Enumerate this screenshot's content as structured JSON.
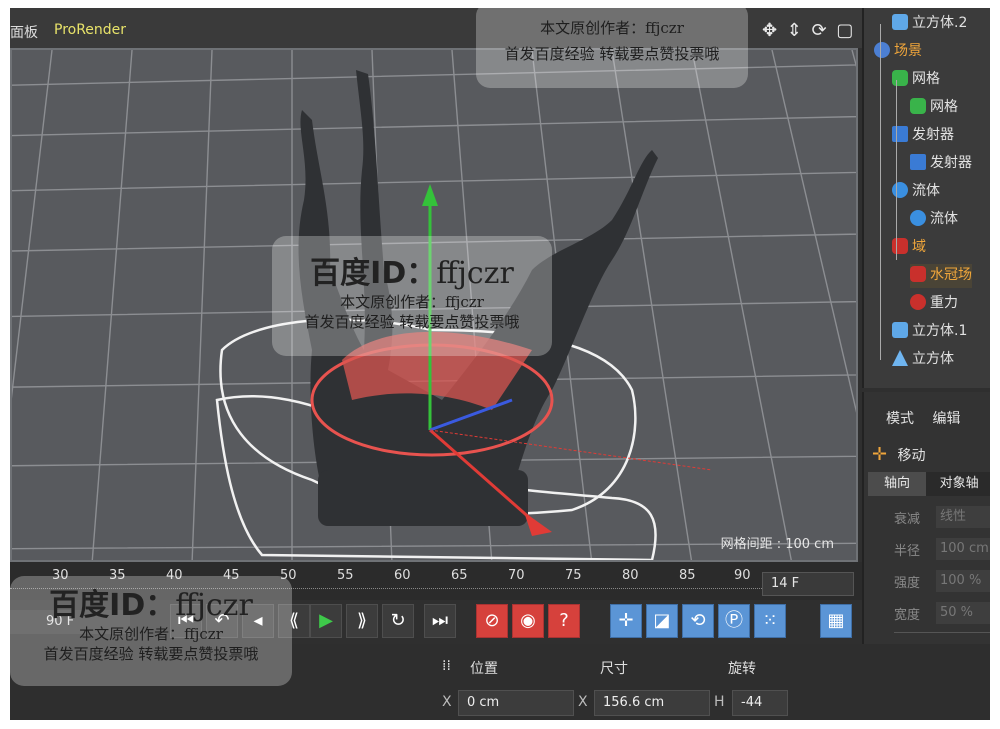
{
  "viewport": {
    "tab_left": "面板",
    "tab_renderer": "ProRender",
    "nav_icons": "✥ ⇕ ⟳ ▢",
    "grid_spacing": "网格间距 : 100 cm"
  },
  "objects": [
    {
      "label": "立方体.2",
      "icon": "cube-icon"
    },
    {
      "label": "场景",
      "icon": "scene-icon"
    },
    {
      "label": "网格",
      "icon": "mesher-icon"
    },
    {
      "label": "网格",
      "icon": "mesher-icon"
    },
    {
      "label": "发射器",
      "icon": "emitter-icon"
    },
    {
      "label": "发射器",
      "icon": "emitter-icon"
    },
    {
      "label": "流体",
      "icon": "fluid-icon"
    },
    {
      "label": "流体",
      "icon": "fluid-icon"
    },
    {
      "label": "域",
      "icon": "domain-icon"
    },
    {
      "label": "水冠场",
      "icon": "crown-field-icon"
    },
    {
      "label": "重力",
      "icon": "gravity-icon"
    },
    {
      "label": "立方体.1",
      "icon": "cube-icon"
    },
    {
      "label": "立方体",
      "icon": "cone-icon"
    }
  ],
  "attributes": {
    "mode_label": "模式",
    "edit_label": "编辑",
    "move_label": "移动",
    "tab_axis": "轴向",
    "tab_object_axis": "对象轴",
    "rows": [
      {
        "label": "衰减",
        "value": "线性"
      },
      {
        "label": "半径",
        "value": "100 cm"
      },
      {
        "label": "强度",
        "value": "100 %"
      },
      {
        "label": "宽度",
        "value": "50 %"
      }
    ]
  },
  "timeline": {
    "ticks": [
      "30",
      "35",
      "40",
      "45",
      "50",
      "55",
      "60",
      "65",
      "70",
      "75",
      "80",
      "85",
      "90"
    ],
    "current_frame": "14 F",
    "start_frame": "90 F"
  },
  "playback_icons": [
    "record-icon",
    "auto-key-icon",
    "help-icon",
    "move-tool-icon",
    "scale-tool-icon",
    "rotate-tool-icon",
    "parameter-icon",
    "points-icon",
    "film-icon"
  ],
  "coordinates": {
    "pos_header": "位置",
    "size_header": "尺寸",
    "rot_header": "旋转",
    "x_label": "X",
    "x_value": "0 cm",
    "size_x_label": "X",
    "size_x_value": "156.6 cm",
    "h_label": "H",
    "h_value": "-44"
  },
  "watermark": {
    "top_line1": "本文原创作者：ffjczr",
    "top_line2": "首发百度经验 转载要点赞投票哦",
    "id_prefix": "百度ID：",
    "id_name": "ffjczr",
    "line1": "本文原创作者：ffjczr",
    "line2": "首发百度经验 转载要点赞投票哦"
  },
  "colors": {
    "viewport_bg": "#585a5e",
    "accent_orange": "#f0a63b",
    "record_red": "#d6413c",
    "tool_blue": "#5b95d6"
  }
}
